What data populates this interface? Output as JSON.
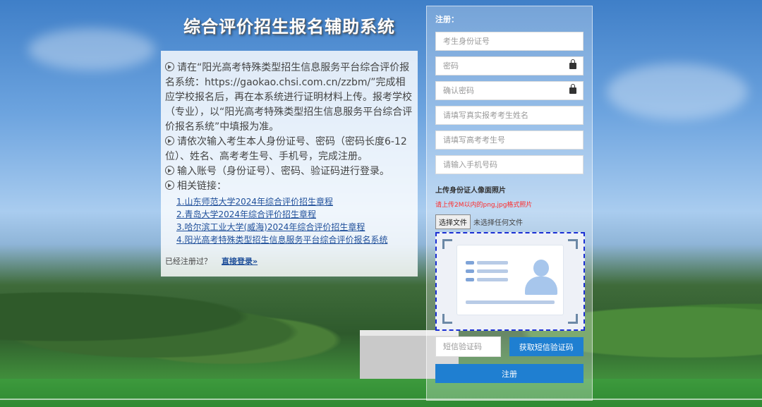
{
  "title": "综合评价招生报名辅助系统",
  "info": {
    "p1": "请在“阳光高考特殊类型招生信息服务平台综合评价报名系统：https://gaokao.chsi.com.cn/zzbm/”完成相应学校报名后，再在本系统进行证明材料上传。报考学校（专业），以“阳光高考特殊类型招生信息服务平台综合评价报名系统”中填报为准。",
    "p2": "请依次输入考生本人身份证号、密码（密码长度6-12位）、姓名、高考考生号、手机号，完成注册。",
    "p3": "输入账号（身份证号）、密码、验证码进行登录。",
    "p4": "相关链接：",
    "links": [
      "1.山东师范大学2024年综合评价招生章程",
      "2.青岛大学2024年综合评价招生章程",
      "3.哈尔滨工业大学(威海)2024年综合评价招生章程",
      "4.阳光高考特殊类型招生信息服务平台综合评价报名系统"
    ],
    "already_text": "已经注册过？",
    "login_link": "直接登录»"
  },
  "register": {
    "title": "注册：",
    "id_placeholder": "考生身份证号",
    "password_placeholder": "密码",
    "confirm_placeholder": "确认密码",
    "name_placeholder": "请填写真实报考考生姓名",
    "exam_no_placeholder": "请填写高考考生号",
    "phone_placeholder": "请输入手机号码",
    "upload_label": "上传身份证人像面照片",
    "upload_tip": "请上传2M以内的png,jpg格式照片",
    "file_button": "选择文件",
    "file_status": "未选择任何文件",
    "sms_placeholder": "短信验证码",
    "sms_button": "获取短信验证码",
    "submit_button": "注册"
  },
  "colors": {
    "accent": "#1f7fd1",
    "link": "#1f4f9a",
    "warning": "#ff2a2a"
  }
}
